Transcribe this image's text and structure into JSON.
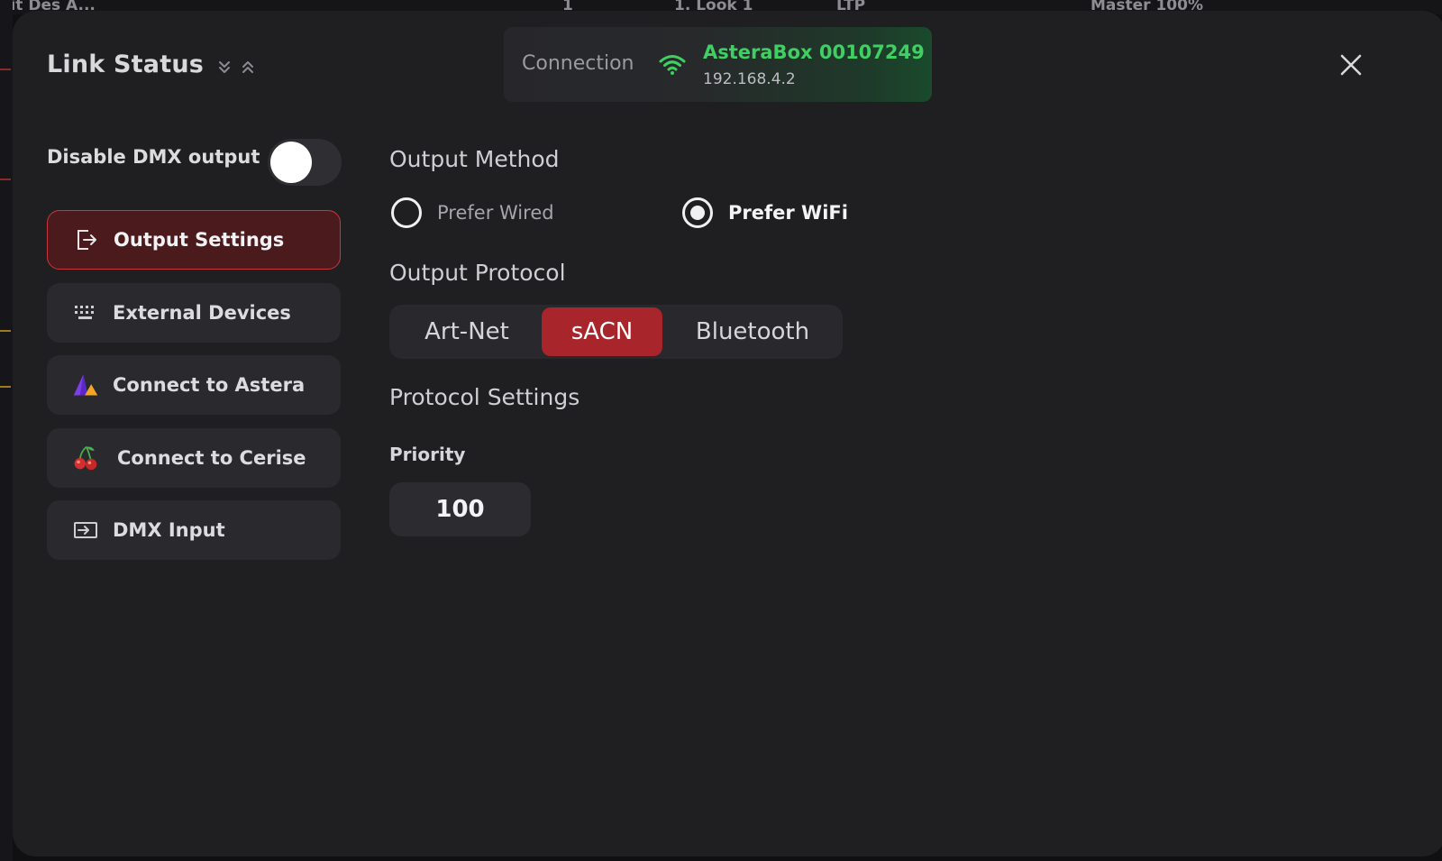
{
  "background": {
    "cells": [
      "ait Des A...",
      "1",
      "1. Look 1",
      "LTP",
      "Master 100%"
    ]
  },
  "dialog": {
    "title": "Link Status",
    "connection": {
      "label": "Connection",
      "device_name": "AsteraBox 00107249",
      "ip": "192.168.4.2",
      "status_color": "#3fcf62"
    }
  },
  "sidebar": {
    "toggle_label": "Disable DMX output",
    "toggle_on": false,
    "items": [
      {
        "label": "Output Settings",
        "icon": "output-icon",
        "active": true
      },
      {
        "label": "External Devices",
        "icon": "keypad-icon",
        "active": false
      },
      {
        "label": "Connect to Astera",
        "icon": "astera-logo-icon",
        "active": false
      },
      {
        "label": "Connect to Cerise",
        "icon": "cherry-icon",
        "active": false
      },
      {
        "label": "DMX Input",
        "icon": "input-icon",
        "active": false
      }
    ]
  },
  "main": {
    "output_method": {
      "title": "Output Method",
      "options": [
        {
          "label": "Prefer Wired",
          "selected": false
        },
        {
          "label": "Prefer WiFi",
          "selected": true
        }
      ]
    },
    "output_protocol": {
      "title": "Output Protocol",
      "options": [
        "Art-Net",
        "sACN",
        "Bluetooth"
      ],
      "selected": "sACN"
    },
    "protocol_settings": {
      "title": "Protocol Settings",
      "priority_label": "Priority",
      "priority_value": "100"
    }
  },
  "colors": {
    "accent": "#a8262b",
    "active_nav_bg": "#4a1a1d",
    "active_nav_border": "#c7383e",
    "dialog_bg": "#1f1f22"
  }
}
